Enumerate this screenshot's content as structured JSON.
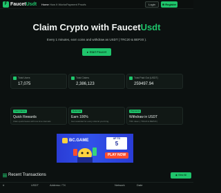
{
  "nav": {
    "brand_main": "Faucet",
    "brand_accent": "Usdt",
    "logo_letter": "F",
    "links": [
      "Home",
      "How It Works",
      "Payment Proofs"
    ],
    "login_label": "Login",
    "register_label": "Register"
  },
  "hero": {
    "title_main": "Claim Crypto with Faucet",
    "title_accent": "Usdt",
    "subtitle": "Every 1 minutes, earn coins and withdraw as USDT ( TRC20 & BEP20 ).",
    "start_label": "Start Faucet"
  },
  "stats": [
    {
      "label": "Total Users",
      "value": "17,075"
    },
    {
      "label": "Total Claims",
      "value": "2,386,123"
    },
    {
      "label": "Total Paid Out (USDT)",
      "value": "259497.94"
    }
  ],
  "features": [
    {
      "badge": "Fast Claims",
      "title": "Quick Rewards",
      "desc": "Claim quick faucet with low time intervals"
    },
    {
      "badge": "Referrals",
      "title": "Earn 100%",
      "desc": "Get rewarded for every referral you bring."
    },
    {
      "badge": "Payments",
      "title": "Withdraw in USDT",
      "desc": "TRC token ( TRC20 & BEP20 )"
    }
  ],
  "ad": {
    "logo": "BC.GAME",
    "upto_line1": "UP TO",
    "upto_line2": "5",
    "play_label": "PLAY NOW"
  },
  "transactions": {
    "title": "Recent Transactions",
    "view_all_label": "View All",
    "columns": [
      "#",
      "USDT",
      "Address / TX",
      "Network",
      "Date"
    ]
  },
  "colors": {
    "accent": "#1fc46b",
    "background": "#0c1110",
    "ad_blue": "#3151e8"
  }
}
